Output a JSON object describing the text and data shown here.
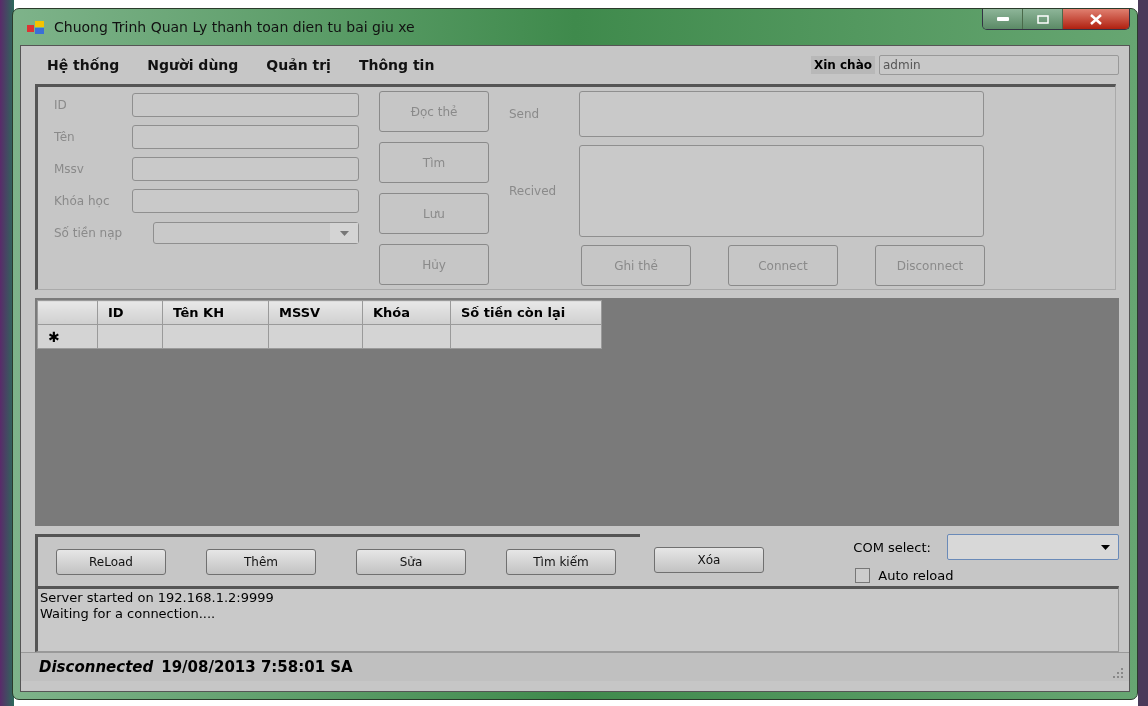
{
  "window": {
    "title": "Chuong Trinh Quan Ly thanh toan dien tu bai giu xe"
  },
  "menu": [
    "Hệ thống",
    "Người dùng",
    "Quản trị",
    "Thông tin"
  ],
  "greeting": {
    "label": "Xin chào",
    "value": "admin"
  },
  "form": {
    "fields": [
      {
        "label": "ID",
        "kind": "text",
        "disabled": true
      },
      {
        "label": "Tên",
        "kind": "text",
        "disabled": true
      },
      {
        "label": "Mssv",
        "kind": "text",
        "disabled": true
      },
      {
        "label": "Khóa học",
        "kind": "text",
        "disabled": true
      },
      {
        "label": "Số tiền nạp",
        "kind": "combo",
        "disabled": true
      }
    ],
    "buttons": [
      {
        "label": "Đọc thẻ",
        "disabled": true
      },
      {
        "label": "Tìm",
        "disabled": true
      },
      {
        "label": "Lưu",
        "disabled": true
      },
      {
        "label": "Hủy",
        "disabled": true
      }
    ],
    "send": {
      "label": "Send",
      "disabled": true
    },
    "received": {
      "label": "Recived",
      "disabled": true
    },
    "card_buttons": [
      {
        "label": "Ghi thẻ",
        "disabled": true
      },
      {
        "label": "Connect",
        "disabled": true
      },
      {
        "label": "Disconnect",
        "disabled": true
      }
    ]
  },
  "table": {
    "columns": [
      "ID",
      "Tên KH",
      "MSSV",
      "Khóa",
      "Số tiền còn lại"
    ],
    "new_row_marker": "✱"
  },
  "actions": [
    {
      "label": "ReLoad"
    },
    {
      "label": "Thêm"
    },
    {
      "label": "Sửa"
    },
    {
      "label": "Tìm kiếm"
    }
  ],
  "delete_button": {
    "label": "Xóa"
  },
  "com_select": {
    "label": "COM select:"
  },
  "auto_reload": {
    "label": "Auto reload",
    "checked": false
  },
  "log": [
    "Server started on 192.168.1.2:9999",
    "Waiting for a connection...."
  ],
  "status_bar": {
    "connection": "Disconnected",
    "datetime": "19/08/2013 7:58:01 SA"
  }
}
